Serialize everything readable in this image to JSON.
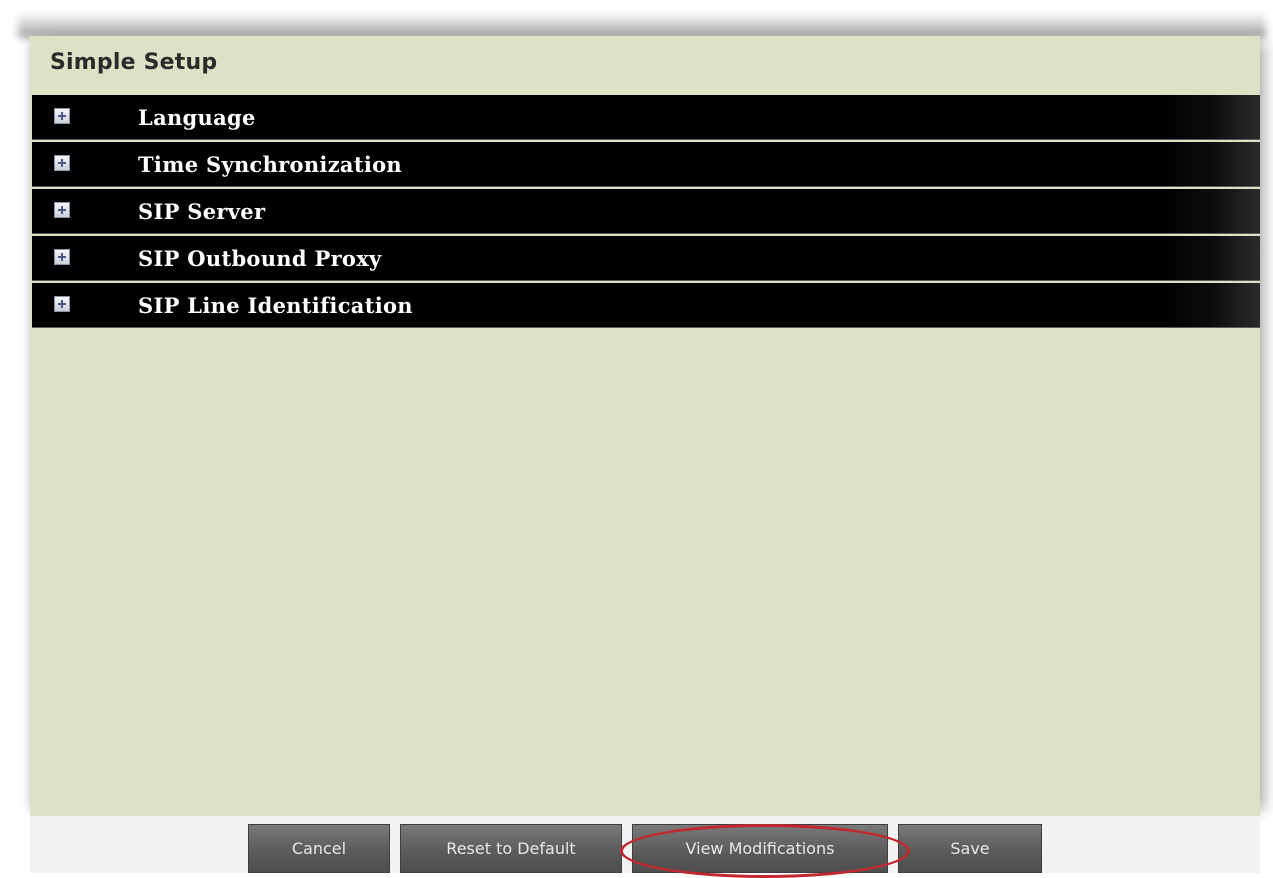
{
  "panel": {
    "title": "Simple Setup"
  },
  "sections": [
    {
      "label": "Language",
      "icon": "expand-plus-icon"
    },
    {
      "label": "Time Synchronization",
      "icon": "expand-plus-icon"
    },
    {
      "label": "SIP Server",
      "icon": "expand-plus-icon"
    },
    {
      "label": "SIP Outbound Proxy",
      "icon": "expand-plus-icon"
    },
    {
      "label": "SIP Line Identification",
      "icon": "expand-plus-icon"
    }
  ],
  "footer": {
    "cancel_label": "Cancel",
    "reset_label": "Reset to Default",
    "view_label": "View Modifications",
    "save_label": "Save"
  },
  "colors": {
    "panel_background": "#dde2c6",
    "section_bar": "#000000",
    "button": "#5b5b5b",
    "highlight": "#c1282f"
  }
}
